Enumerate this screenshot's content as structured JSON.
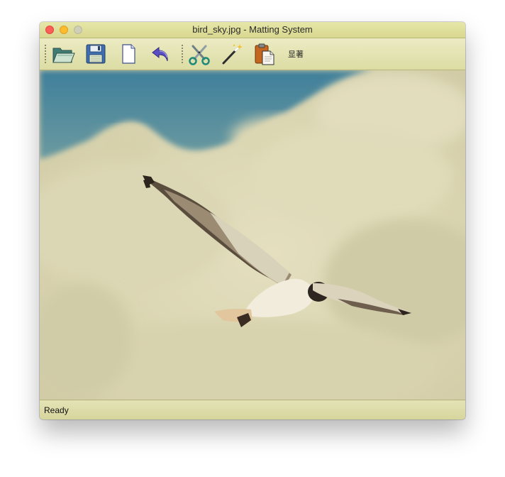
{
  "window": {
    "title": "bird_sky.jpg - Matting System"
  },
  "toolbar": {
    "buttons": [
      {
        "icon": "open-folder-icon"
      },
      {
        "icon": "save-disk-icon"
      },
      {
        "icon": "new-document-icon"
      },
      {
        "icon": "undo-arrow-icon"
      },
      {
        "icon": "scissors-icon"
      },
      {
        "icon": "magic-wand-icon"
      },
      {
        "icon": "clipboard-paste-icon"
      }
    ],
    "saliency_label": "显著"
  },
  "canvas": {
    "image_subject": "seagull in cloudy sky"
  },
  "statusbar": {
    "text": "Ready"
  },
  "colors": {
    "chrome": "#e6e4b4",
    "sky_blue": "#4f8ba0",
    "cloud": "#d8d4ae"
  }
}
